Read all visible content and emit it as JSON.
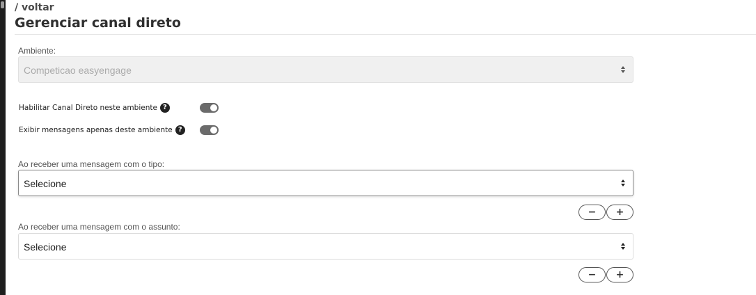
{
  "header": {
    "back_link": "/ voltar",
    "title": "Gerenciar canal direto"
  },
  "ambiente": {
    "label": "Ambiente:",
    "value": "Competicao easyengage",
    "disabled": true
  },
  "toggles": [
    {
      "label": "Habilitar Canal Direto neste ambiente",
      "help_icon": "question-circle-icon",
      "on": true
    },
    {
      "label": "Exibir mensagens apenas deste ambiente",
      "help_icon": "question-circle-icon",
      "on": true
    }
  ],
  "tipo": {
    "label": "Ao receber uma mensagem com o tipo:",
    "value": "Selecione"
  },
  "assunto": {
    "label": "Ao receber uma mensagem com o assunto:",
    "value": "Selecione"
  },
  "stepper": {
    "minus_label": "−",
    "plus_label": "+"
  },
  "icons": {
    "help": "?",
    "select_arrows": "sort-arrows-icon"
  },
  "colors": {
    "toggle_on": "#6b6b6b",
    "title": "#2f2f2f"
  }
}
